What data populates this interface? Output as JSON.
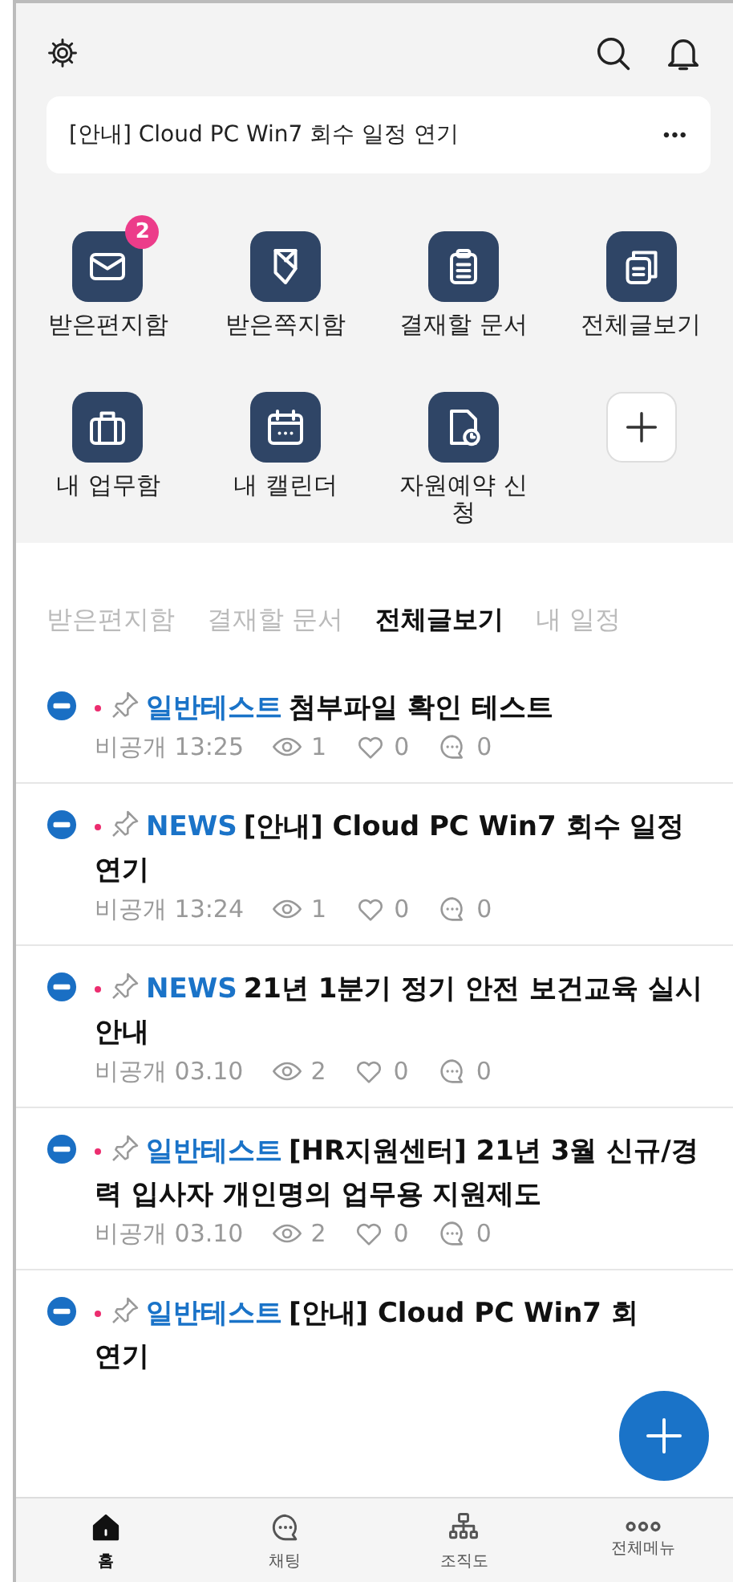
{
  "notice": {
    "text": "[안내] Cloud PC Win7 회수 일정 연기",
    "more": "•••"
  },
  "shortcuts": [
    {
      "kind": "app",
      "label": "받은편지함",
      "badge": "2"
    },
    {
      "kind": "app",
      "label": "받은쪽지함"
    },
    {
      "kind": "app",
      "label": "결재할 문서"
    },
    {
      "kind": "app",
      "label": "전체글보기"
    },
    {
      "kind": "app",
      "label": "내 업무함"
    },
    {
      "kind": "app",
      "label": "내 캘린더"
    },
    {
      "kind": "app",
      "label": "자원예약 신청"
    },
    {
      "kind": "add"
    }
  ],
  "tabs": [
    {
      "label": "받은편지함",
      "selected": false
    },
    {
      "label": "결재할 문서",
      "selected": false
    },
    {
      "label": "전체글보기",
      "selected": true
    },
    {
      "label": "내 일정",
      "selected": false
    }
  ],
  "posts": [
    {
      "new": true,
      "category": "일반테스트",
      "title": "첨부파일 확인 테스트",
      "meta": {
        "visibility": "비공개",
        "time": "13:25",
        "views": "1",
        "likes": "0",
        "comments": "0"
      }
    },
    {
      "new": true,
      "category": "NEWS",
      "title": "[안내] Cloud PC Win7 회수 일정 연기",
      "meta": {
        "visibility": "비공개",
        "time": "13:24",
        "views": "1",
        "likes": "0",
        "comments": "0"
      }
    },
    {
      "new": true,
      "category": "NEWS",
      "title": "21년 1분기 정기 안전 보건교육 실시 안내",
      "meta": {
        "visibility": "비공개",
        "time": "03.10",
        "views": "2",
        "likes": "0",
        "comments": "0"
      }
    },
    {
      "new": true,
      "category": "일반테스트",
      "title": "[HR지원센터] 21년 3월 신규/경력 입사자 개인명의 업무용 지원제도",
      "meta": {
        "visibility": "비공개",
        "time": "03.10",
        "views": "2",
        "likes": "0",
        "comments": "0"
      }
    },
    {
      "new": true,
      "category": "일반테스트",
      "title": "[안내] Cloud PC Win7 회",
      "title_end": "연기"
    }
  ],
  "nav": [
    {
      "label": "홈",
      "selected": true
    },
    {
      "label": "채팅",
      "selected": false
    },
    {
      "label": "조직도",
      "selected": false
    },
    {
      "label": "전체메뉴",
      "selected": false
    }
  ]
}
